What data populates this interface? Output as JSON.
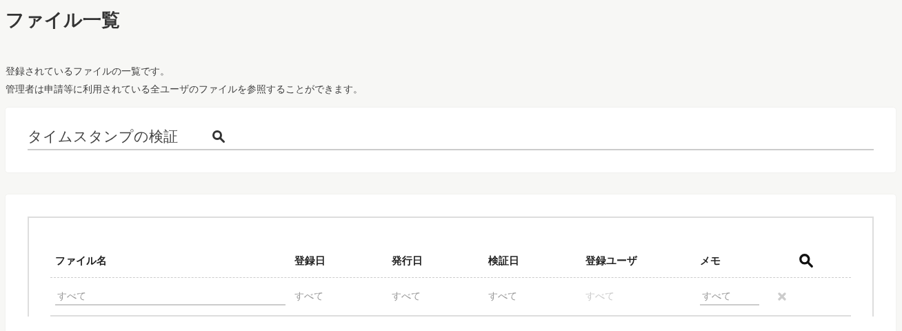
{
  "page": {
    "title": "ファイル一覧",
    "description": [
      "登録されているファイルの一覧です。",
      "管理者は申請等に利用されている全ユーザのファイルを参照することができます。"
    ]
  },
  "timestamp_search": {
    "placeholder": "タイムスタンプの検証"
  },
  "table": {
    "columns": [
      "ファイル名",
      "登録日",
      "発行日",
      "検証日",
      "登録ユーザ",
      "メモ"
    ],
    "filters": [
      {
        "kind": "input",
        "placeholder": "すべて",
        "disabled": false
      },
      {
        "kind": "select",
        "value": "すべて",
        "disabled": false
      },
      {
        "kind": "select",
        "value": "すべて",
        "disabled": false
      },
      {
        "kind": "select",
        "value": "すべて",
        "disabled": false
      },
      {
        "kind": "select",
        "value": "すべて",
        "disabled": true
      },
      {
        "kind": "input",
        "placeholder": "すべて",
        "disabled": false
      }
    ]
  }
}
